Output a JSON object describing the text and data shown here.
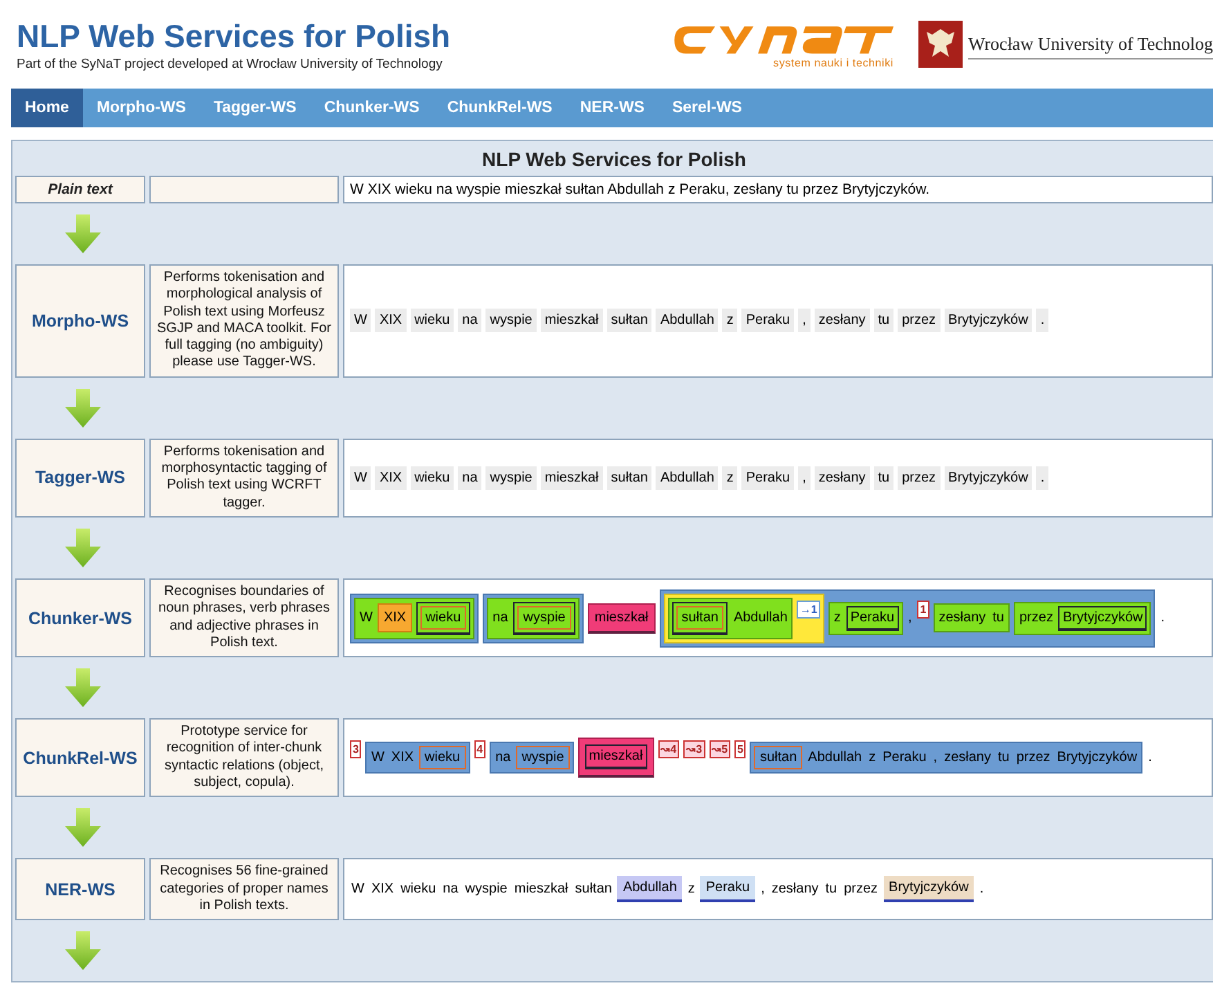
{
  "header": {
    "title": "NLP Web Services for Polish",
    "subtitle": "Part of the SyNaT project developed at Wrocław University of Technology",
    "synat_tagline": "system nauki i techniki",
    "university": "Wrocław University of Technolog"
  },
  "nav": [
    {
      "label": "Home",
      "selected": true
    },
    {
      "label": "Morpho-WS",
      "selected": false
    },
    {
      "label": "Tagger-WS",
      "selected": false
    },
    {
      "label": "Chunker-WS",
      "selected": false
    },
    {
      "label": "ChunkRel-WS",
      "selected": false
    },
    {
      "label": "NER-WS",
      "selected": false
    },
    {
      "label": "Serel-WS",
      "selected": false
    }
  ],
  "main": {
    "title": "NLP Web Services for Polish",
    "input_row": {
      "label": "Plain text",
      "text": "W XIX wieku na wyspie mieszkał sułtan Abdullah z Peraku, zesłany tu przez Brytyjczyków."
    },
    "services": [
      {
        "name": "Morpho-WS",
        "description": "Performs tokenisation and morphological analysis of Polish text using Morfeusz SGJP and MACA toolkit. For full tagging (no ambiguity) please use Tagger-WS.",
        "output": [
          {
            "kind": "token",
            "text": "W"
          },
          {
            "kind": "token",
            "text": "XIX"
          },
          {
            "kind": "token",
            "text": "wieku"
          },
          {
            "kind": "token",
            "text": "na"
          },
          {
            "kind": "token",
            "text": "wyspie"
          },
          {
            "kind": "token",
            "text": "mieszkał"
          },
          {
            "kind": "token",
            "text": "sułtan"
          },
          {
            "kind": "token",
            "text": "Abdullah"
          },
          {
            "kind": "token",
            "text": "z"
          },
          {
            "kind": "token",
            "text": "Peraku"
          },
          {
            "kind": "token",
            "text": ","
          },
          {
            "kind": "token",
            "text": "zesłany"
          },
          {
            "kind": "token",
            "text": "tu"
          },
          {
            "kind": "token",
            "text": "przez"
          },
          {
            "kind": "token",
            "text": "Brytyjczyków"
          },
          {
            "kind": "token",
            "text": "."
          }
        ]
      },
      {
        "name": "Tagger-WS",
        "description": "Performs tokenisation and morphosyntactic tagging of Polish text using WCRFT tagger.",
        "output": [
          {
            "kind": "token",
            "text": "W"
          },
          {
            "kind": "token",
            "text": "XIX"
          },
          {
            "kind": "token",
            "text": "wieku"
          },
          {
            "kind": "token",
            "text": "na"
          },
          {
            "kind": "token",
            "text": "wyspie"
          },
          {
            "kind": "token",
            "text": "mieszkał"
          },
          {
            "kind": "token",
            "text": "sułtan"
          },
          {
            "kind": "token",
            "text": "Abdullah"
          },
          {
            "kind": "token",
            "text": "z"
          },
          {
            "kind": "token",
            "text": "Peraku"
          },
          {
            "kind": "token",
            "text": ","
          },
          {
            "kind": "token",
            "text": "zesłany"
          },
          {
            "kind": "token",
            "text": "tu"
          },
          {
            "kind": "token",
            "text": "przez"
          },
          {
            "kind": "token",
            "text": "Brytyjczyków"
          },
          {
            "kind": "token",
            "text": "."
          }
        ]
      },
      {
        "name": "Chunker-WS",
        "description": "Recognises boundaries of noun phrases, verb phrases and adjective phrases in Polish text.",
        "output": [
          {
            "kind": "np",
            "children": [
              {
                "kind": "ap",
                "children": [
                  {
                    "kind": "word",
                    "text": "W"
                  },
                  {
                    "kind": "adjp",
                    "text": "XIX"
                  },
                  {
                    "kind": "head",
                    "children": [
                      {
                        "kind": "synh",
                        "text": "wieku"
                      }
                    ]
                  }
                ]
              }
            ]
          },
          {
            "kind": "np",
            "children": [
              {
                "kind": "ap",
                "children": [
                  {
                    "kind": "word",
                    "text": "na"
                  },
                  {
                    "kind": "head",
                    "children": [
                      {
                        "kind": "synh",
                        "text": "wyspie"
                      }
                    ]
                  }
                ]
              }
            ]
          },
          {
            "kind": "vp",
            "text": "mieszkał"
          },
          {
            "kind": "np",
            "children": [
              {
                "kind": "agp",
                "children": [
                  {
                    "kind": "ap",
                    "children": [
                      {
                        "kind": "head",
                        "children": [
                          {
                            "kind": "synh",
                            "text": "sułtan"
                          }
                        ]
                      },
                      {
                        "kind": "word",
                        "text": "Abdullah"
                      }
                    ]
                  },
                  {
                    "kind": "ref",
                    "text": "→1"
                  }
                ]
              },
              {
                "kind": "ap",
                "children": [
                  {
                    "kind": "word",
                    "text": "z"
                  },
                  {
                    "kind": "head",
                    "text": "Peraku"
                  }
                ]
              },
              {
                "kind": "punct",
                "text": ","
              },
              {
                "kind": "marker",
                "text": "1"
              },
              {
                "kind": "ap",
                "children": [
                  {
                    "kind": "word",
                    "text": "zesłany"
                  },
                  {
                    "kind": "word",
                    "text": "tu"
                  }
                ]
              },
              {
                "kind": "ap",
                "children": [
                  {
                    "kind": "word",
                    "text": "przez"
                  },
                  {
                    "kind": "head",
                    "text": "Brytyjczyków"
                  }
                ]
              }
            ]
          },
          {
            "kind": "punct",
            "text": "."
          }
        ]
      },
      {
        "name": "ChunkRel-WS",
        "description": "Prototype service for recognition of inter-chunk syntactic relations (object, subject, copula).",
        "output": [
          {
            "kind": "marker",
            "text": "3"
          },
          {
            "kind": "np",
            "children": [
              {
                "kind": "word",
                "text": "W"
              },
              {
                "kind": "word",
                "text": "XIX"
              },
              {
                "kind": "synh",
                "text": "wieku"
              }
            ]
          },
          {
            "kind": "marker",
            "text": "4"
          },
          {
            "kind": "np",
            "children": [
              {
                "kind": "word",
                "text": "na"
              },
              {
                "kind": "synh",
                "text": "wyspie"
              }
            ]
          },
          {
            "kind": "vp",
            "children": [
              {
                "kind": "head",
                "text": "mieszkał"
              }
            ]
          },
          {
            "kind": "rel",
            "text": "↝4"
          },
          {
            "kind": "rel",
            "text": "↝3"
          },
          {
            "kind": "rel",
            "text": "↝5"
          },
          {
            "kind": "marker",
            "text": "5"
          },
          {
            "kind": "np",
            "children": [
              {
                "kind": "synh",
                "text": "sułtan"
              },
              {
                "kind": "word",
                "text": "Abdullah"
              },
              {
                "kind": "word",
                "text": "z"
              },
              {
                "kind": "word",
                "text": "Peraku"
              },
              {
                "kind": "word",
                "text": ","
              },
              {
                "kind": "word",
                "text": "zesłany"
              },
              {
                "kind": "word",
                "text": "tu"
              },
              {
                "kind": "word",
                "text": "przez"
              },
              {
                "kind": "word",
                "text": "Brytyjczyków"
              }
            ]
          },
          {
            "kind": "punct",
            "text": "."
          }
        ]
      },
      {
        "name": "NER-WS",
        "description": "Recognises 56 fine-grained categories of proper names in Polish texts.",
        "output": [
          {
            "kind": "word",
            "text": "W"
          },
          {
            "kind": "word",
            "text": "XIX"
          },
          {
            "kind": "word",
            "text": "wieku"
          },
          {
            "kind": "word",
            "text": "na"
          },
          {
            "kind": "word",
            "text": "wyspie"
          },
          {
            "kind": "word",
            "text": "mieszkał"
          },
          {
            "kind": "word",
            "text": "sułtan"
          },
          {
            "kind": "entity",
            "text": "Abdullah",
            "color": "#c6c8f4"
          },
          {
            "kind": "word",
            "text": "z"
          },
          {
            "kind": "entity",
            "text": "Peraku",
            "color": "#cfe0f4"
          },
          {
            "kind": "punct",
            "text": ","
          },
          {
            "kind": "word",
            "text": "zesłany"
          },
          {
            "kind": "word",
            "text": "tu"
          },
          {
            "kind": "word",
            "text": "przez"
          },
          {
            "kind": "entity",
            "text": "Brytyjczyków",
            "color": "#eedcc4"
          },
          {
            "kind": "punct",
            "text": "."
          }
        ]
      }
    ]
  }
}
